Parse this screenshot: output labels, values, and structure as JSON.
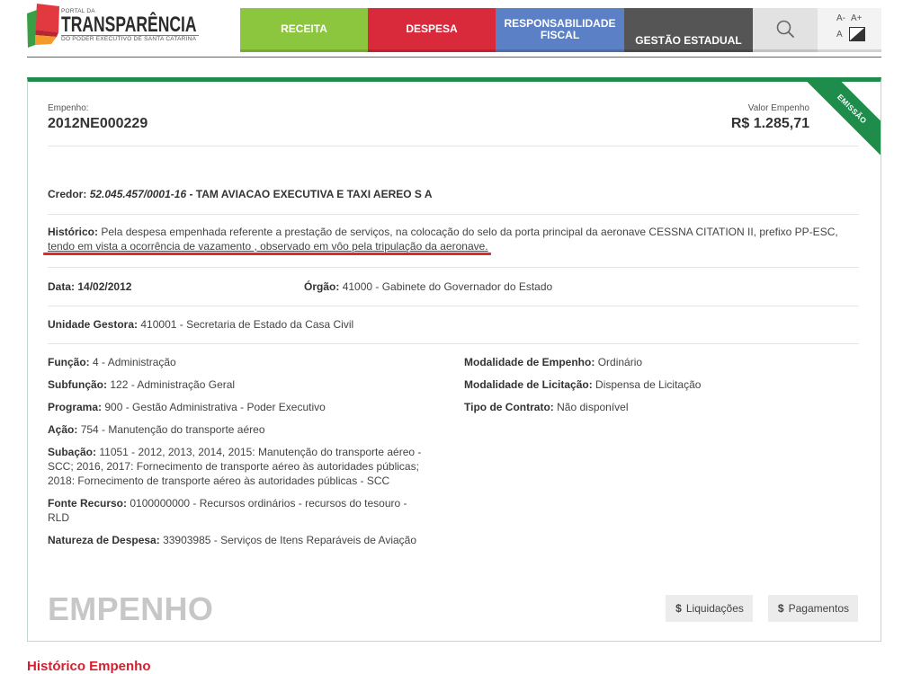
{
  "header": {
    "logo": {
      "top_text": "PORTAL DA",
      "main_text": "TRANSPARÊNCIA",
      "sub_text": "DO PODER EXECUTIVO DE SANTA CATARINA"
    },
    "nav": {
      "receita": {
        "label": "RECEITA",
        "color": "#8cc63f"
      },
      "despesa": {
        "label": "DESPESA",
        "color": "#d92a3c"
      },
      "responsabilidade_fiscal": {
        "label_line1": "RESPONSABILIDADE",
        "label_line2": "FISCAL",
        "color": "#5b80c6"
      },
      "gestao_estadual": {
        "label": "GESTÃO ESTADUAL",
        "color": "#555555"
      }
    },
    "search": {
      "icon": "search-icon",
      "color": "#e2e2e2"
    },
    "accessibility": {
      "decrease_font": "A-",
      "increase_font": "A+",
      "contrast_label": "A",
      "contrast_icon": "contrast-icon"
    }
  },
  "empenho_card": {
    "number_label": "Empenho:",
    "number": "2012NE000229",
    "value_label": "Valor Empenho",
    "value": "R$ 1.285,71",
    "status_ribbon": "EMISSÃO",
    "accent_color": "#1e8c4a",
    "credor": {
      "label": "Credor:",
      "cnpj": "52.045.457/0001-16",
      "separator": " - ",
      "name": "TAM AVIACAO EXECUTIVA E TAXI AEREO S A"
    },
    "historico": {
      "label": "Histórico:",
      "text_line1": "Pela despesa empenhada referente a prestação de serviços, na colocação do selo da porta principal da aeronave CESSNA CITATION II, prefixo PP-ESC,",
      "text_line2": "tendo em vista a ocorrência de vazamento , observado em vôo pela tripulação da aeronave.",
      "annotation_color": "#e0262f"
    },
    "data": {
      "label": "Data:",
      "value": "14/02/2012"
    },
    "orgao": {
      "label": "Órgão:",
      "value": "41000 - Gabinete do Governador do Estado"
    },
    "unidade_gestora": {
      "label": "Unidade Gestora:",
      "value": "410001 - Secretaria de Estado da Casa Civil"
    },
    "details_left": [
      {
        "label": "Função:",
        "value": "4 - Administração"
      },
      {
        "label": "Subfunção:",
        "value": "122 - Administração Geral"
      },
      {
        "label": "Programa:",
        "value": "900 - Gestão Administrativa - Poder Executivo"
      },
      {
        "label": "Ação:",
        "value": "754 - Manutenção do transporte aéreo"
      },
      {
        "label": "Subação:",
        "value": "11051 - 2012, 2013, 2014, 2015: Manutenção do transporte aéreo - SCC; 2016, 2017: Fornecimento de transporte aéreo às autoridades públicas; 2018: Fornecimento de transporte aéreo às autoridades públicas - SCC"
      },
      {
        "label": "Fonte Recurso:",
        "value": "0100000000 - Recursos ordinários - recursos do tesouro - RLD"
      },
      {
        "label": "Natureza de Despesa:",
        "value": "33903985 - Serviços de Itens Reparáveis de Aviação"
      }
    ],
    "details_right": [
      {
        "label": "Modalidade de Empenho:",
        "value": "Ordinário"
      },
      {
        "label": "Modalidade de Licitação:",
        "value": "Dispensa de Licitação"
      },
      {
        "label": "Tipo de Contrato:",
        "value": "Não disponível"
      }
    ],
    "section_title": "EMPENHO",
    "actions": [
      {
        "icon": "dollar-icon",
        "icon_glyph": "$",
        "label": "Liquidações"
      },
      {
        "icon": "dollar-icon",
        "icon_glyph": "$",
        "label": "Pagamentos"
      }
    ]
  },
  "historico_section": {
    "title": "Histórico Empenho",
    "color": "#d32030"
  }
}
